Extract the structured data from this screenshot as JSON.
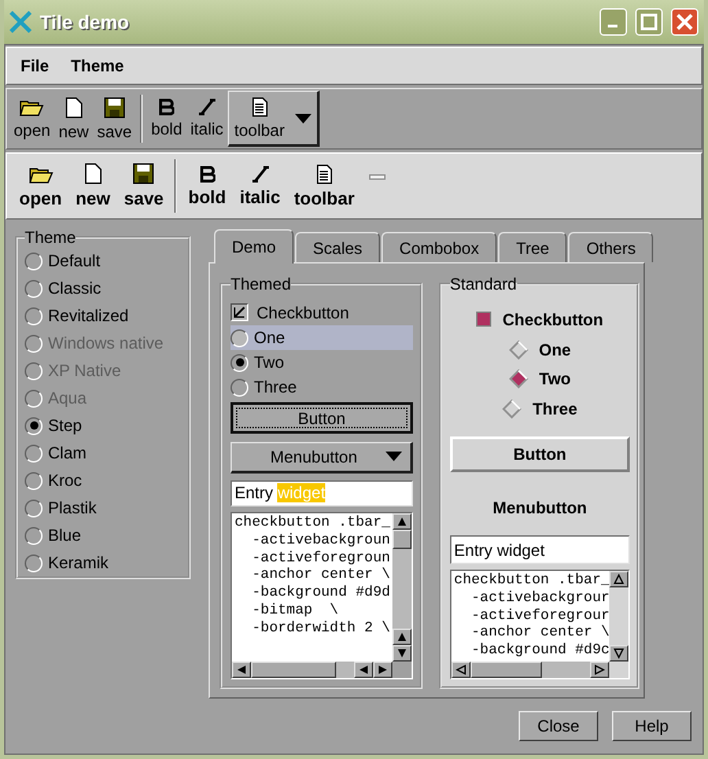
{
  "window": {
    "title": "Tile demo"
  },
  "menu": [
    "File",
    "Theme"
  ],
  "toolbar_dark": [
    {
      "kind": "open",
      "label": "open"
    },
    {
      "kind": "new",
      "label": "new"
    },
    {
      "kind": "save",
      "label": "save"
    },
    {
      "kind": "separator"
    },
    {
      "kind": "bold",
      "label": "bold"
    },
    {
      "kind": "italic",
      "label": "italic"
    },
    {
      "kind": "menu",
      "label": "toolbar"
    }
  ],
  "toolbar_light": [
    {
      "kind": "open",
      "label": "open"
    },
    {
      "kind": "new",
      "label": "new"
    },
    {
      "kind": "save",
      "label": "save"
    },
    {
      "kind": "separator"
    },
    {
      "kind": "bold",
      "label": "bold"
    },
    {
      "kind": "italic",
      "label": "italic"
    },
    {
      "kind": "doc",
      "label": "toolbar"
    },
    {
      "kind": "handle"
    }
  ],
  "theme_group": {
    "title": "Theme",
    "options": [
      {
        "label": "Default",
        "selected": false,
        "disabled": false
      },
      {
        "label": "Classic",
        "selected": false,
        "disabled": false
      },
      {
        "label": "Revitalized",
        "selected": false,
        "disabled": false
      },
      {
        "label": "Windows native",
        "selected": false,
        "disabled": true
      },
      {
        "label": "XP Native",
        "selected": false,
        "disabled": true
      },
      {
        "label": "Aqua",
        "selected": false,
        "disabled": true
      },
      {
        "label": "Step",
        "selected": true,
        "disabled": false
      },
      {
        "label": "Clam",
        "selected": false,
        "disabled": false
      },
      {
        "label": "Kroc",
        "selected": false,
        "disabled": false
      },
      {
        "label": "Plastik",
        "selected": false,
        "disabled": false
      },
      {
        "label": "Blue",
        "selected": false,
        "disabled": false
      },
      {
        "label": "Keramik",
        "selected": false,
        "disabled": false
      }
    ]
  },
  "tabs": [
    {
      "label": "Demo",
      "selected": true
    },
    {
      "label": "Scales",
      "selected": false
    },
    {
      "label": "Combobox",
      "selected": false
    },
    {
      "label": "Tree",
      "selected": false
    },
    {
      "label": "Others",
      "selected": false
    }
  ],
  "themed": {
    "title": "Themed",
    "checkbutton": {
      "label": "Checkbutton",
      "checked": true
    },
    "radios": [
      {
        "label": "One",
        "selected": false,
        "hovered": true
      },
      {
        "label": "Two",
        "selected": true,
        "hovered": false
      },
      {
        "label": "Three",
        "selected": false,
        "hovered": false
      }
    ],
    "button": "Button",
    "menubutton": "Menubutton",
    "entry": {
      "value": "Entry ",
      "selected_text": "widget"
    },
    "text_lines": [
      "checkbutton .tbar_",
      "  -activebackgroun",
      "  -activeforegroun",
      "  -anchor center \\",
      "  -background #d9d",
      "  -bitmap  \\",
      "  -borderwidth 2 \\"
    ]
  },
  "standard": {
    "title": "Standard",
    "checkbutton": {
      "label": "Checkbutton",
      "checked": true
    },
    "radios": [
      {
        "label": "One",
        "selected": false
      },
      {
        "label": "Two",
        "selected": true
      },
      {
        "label": "Three",
        "selected": false
      }
    ],
    "button": "Button",
    "menubutton": "Menubutton",
    "entry": {
      "value": "Entry widget"
    },
    "text_lines": [
      "checkbutton .tbar_",
      "  -activebackgrour",
      "  -activeforegrour",
      "  -anchor center \\",
      "  -background #d9c"
    ]
  },
  "footer_buttons": [
    "Close",
    "Help"
  ]
}
